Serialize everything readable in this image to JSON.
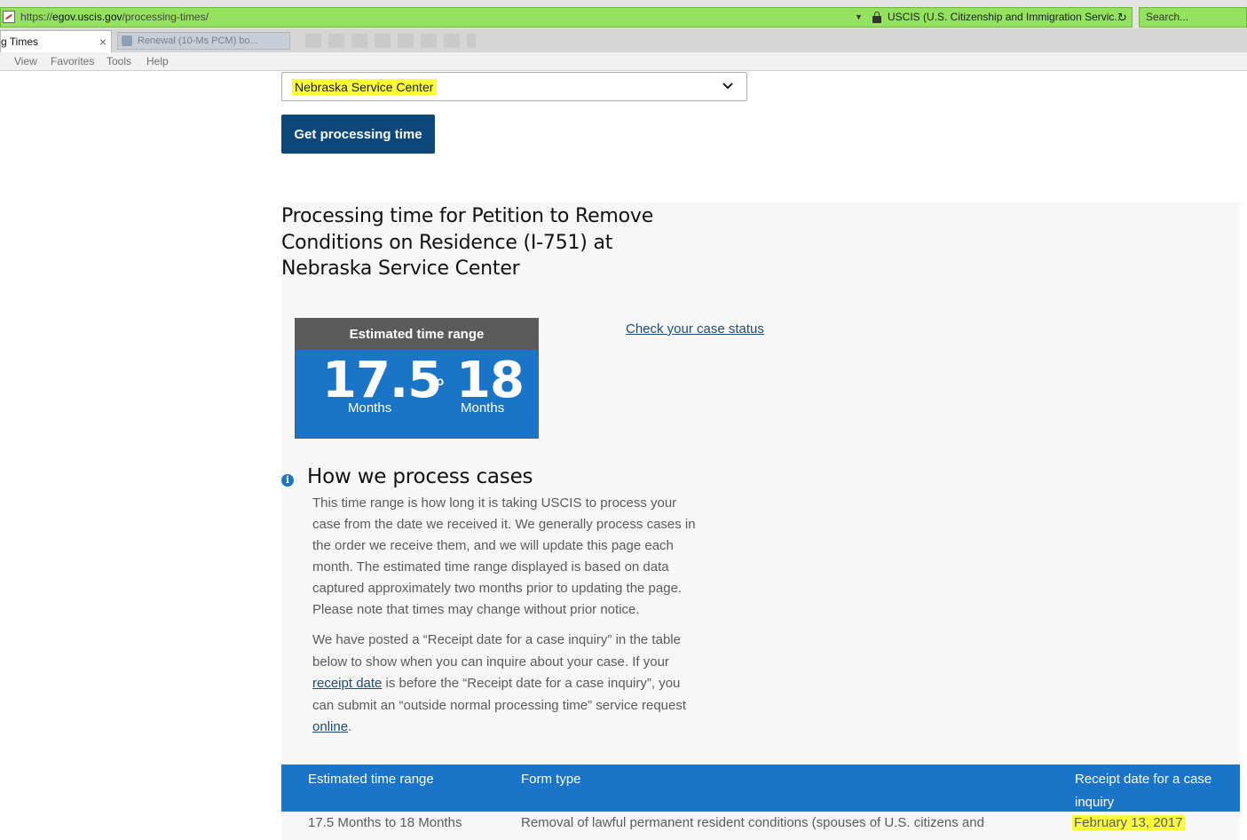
{
  "browser": {
    "url_scheme": "https://",
    "url_host": "egov.uscis.gov",
    "url_path": "/processing-times/",
    "site_identity": "USCIS (U.S. Citizenship and Immigration Servic...",
    "search_placeholder": "Search...",
    "active_tab_title": "g Times",
    "tab_close_glyph": "×",
    "other_tab_title": "Renewal (10-Ms PCM) bo...",
    "menu": [
      "View",
      "Favorites",
      "Tools",
      "Help"
    ],
    "icons": [
      "page-icon",
      "lock-icon",
      "refresh-icon",
      "dropdown-arrow-icon",
      "close-icon"
    ]
  },
  "form": {
    "office_select_value": "Nebraska Service Center",
    "submit_label": "Get processing time",
    "highlight_color": "#fbff3a",
    "button_color": "#0b4778"
  },
  "result": {
    "title_line1": "Processing time for Petition to Remove",
    "title_line2": "Conditions on Residence (I-751) at",
    "title_line3": "Nebraska Service Center",
    "card_header": "Estimated time range",
    "min_value": "17.5",
    "min_unit": "Months",
    "connector": "to",
    "max_value": "18",
    "max_unit": "Months",
    "case_status_link": "Check your case status",
    "accent_color": "#1a74c7"
  },
  "how_we_process": {
    "heading": "How we process cases",
    "para1_lines": [
      "This time range is how long it is taking USCIS to process your",
      "case from the date we received it. We generally process cases in",
      "the order we receive them, and we will update this page each",
      "month. The estimated time range displayed is based on data",
      "captured approximately two months prior to updating the page.",
      "Please note that times may change without prior notice."
    ],
    "para2_line1": "We have posted a “Receipt date for a case inquiry” in the table",
    "para2_line2": "below to show when you can inquire about your case. If your",
    "para2_link1": "receipt date",
    "para2_line3_rest": " is before the “Receipt date for a case inquiry”, you",
    "para2_line4": "can submit an “outside normal processing time” service request",
    "para2_link2": "online",
    "para2_end": "."
  },
  "table": {
    "headers": [
      "Estimated time range",
      "Form type",
      "Receipt date for a case",
      "inquiry"
    ],
    "row": {
      "range": "17.5 Months to 18 Months",
      "form_type": "Removal of lawful permanent resident conditions (spouses of U.S. citizens and",
      "receipt_date": "February 13, 2017"
    }
  }
}
